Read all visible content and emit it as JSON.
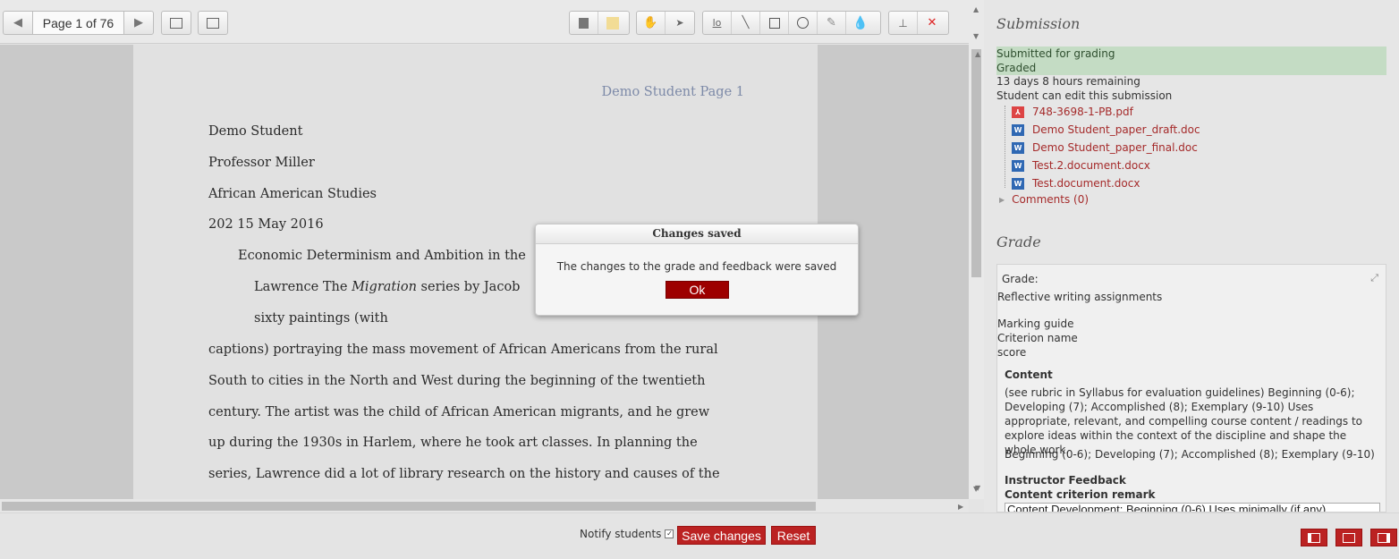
{
  "toolbar": {
    "page_label": "Page 1 of 76",
    "prev_icon": "triangle-left-icon",
    "next_icon": "triangle-right-icon"
  },
  "document": {
    "header": "Demo Student Page 1",
    "lines": [
      "Demo Student",
      "Professor Miller",
      "African American Studies",
      "202 15 May 2016",
      "Economic Determinism and Ambition in the",
      "Lawrence The ",
      "Migration",
      " series by Jacob",
      "sixty paintings (with",
      "captions) portraying the mass movement of African Americans from the rural",
      "South to cities in the North and West during the beginning of the twentieth",
      "century. The artist was the child of African American migrants, and he grew",
      "up during the 1930s in Harlem, where he took art classes. In planning the",
      "series, Lawrence did a lot of library research on the history and causes of the"
    ]
  },
  "modal": {
    "title": "Changes saved",
    "message": "The changes to the grade and feedback were saved",
    "ok_label": "Ok"
  },
  "submission": {
    "title": "Submission",
    "status": [
      "Submitted for grading",
      "Graded"
    ],
    "time_remaining": "13 days 8 hours remaining",
    "edit_note": "Student can edit this submission",
    "files": [
      {
        "name": "748-3698-1-PB.pdf",
        "icon": "pdf-icon"
      },
      {
        "name": "Demo Student_paper_draft.doc",
        "icon": "word-icon"
      },
      {
        "name": "Demo Student_paper_final.doc",
        "icon": "word-icon"
      },
      {
        "name": "Test.2.document.docx",
        "icon": "word-icon"
      },
      {
        "name": "Test.document.docx",
        "icon": "word-icon"
      }
    ],
    "comments_label": "Comments (0)"
  },
  "grade": {
    "title": "Grade",
    "grade_label": "Grade:",
    "assignment_type": "Reflective writing assignments",
    "marking_guide": "Marking guide",
    "criterion_name": "Criterion name",
    "score": "score",
    "criterion_title": "Content",
    "criterion_desc": "(see rubric in Syllabus for evaluation guidelines) Beginning (0-6); Developing (7); Accomplished (8); Exemplary (9-10) Uses appropriate, relevant, and compelling course content / readings to explore ideas within the context of the discipline and shape the whole work.",
    "criterion_levels": "Beginning (0-6); Developing (7); Accomplished (8); Exemplary (9-10)",
    "feedback_title": "Instructor Feedback",
    "remark_label": "Content criterion remark",
    "remark_value": "Content Development: Beginning (0-6) Uses minimally (if any)"
  },
  "footer": {
    "notify_label": "Notify students",
    "save_label": "Save changes",
    "reset_label": "Reset"
  },
  "colors": {
    "accent_red": "#b22222",
    "modal_ok": "#9d0000",
    "status_green": "#c4dcc4",
    "file_link": "#a52a2a"
  }
}
